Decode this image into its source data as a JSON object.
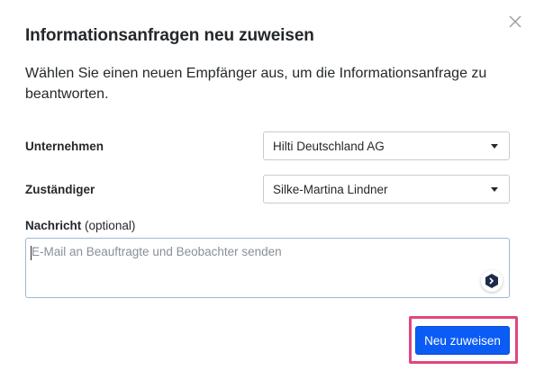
{
  "dialog": {
    "title": "Informationsanfragen neu zuweisen",
    "description": "Wählen Sie einen neuen Empfänger aus, um die Informationsanfrage zu beantworten."
  },
  "fields": {
    "company_label": "Unternehmen",
    "company_value": "Hilti Deutschland AG",
    "assignee_label": "Zuständiger",
    "assignee_value": "Silke-Martina Lindner",
    "message_label": "Nachricht",
    "message_optional": "(optional)",
    "message_placeholder": "E-Mail an Beauftragte und Beobachter senden",
    "message_value": ""
  },
  "actions": {
    "submit_label": "Neu zuweisen"
  },
  "icons": {
    "close": "close-icon",
    "dropdown": "caret-down-icon",
    "grammar": "grammar-assistant-icon"
  },
  "colors": {
    "primary": "#0b5cf5",
    "highlight": "#e2457f",
    "text": "#25282b",
    "placeholder": "#8a9097"
  }
}
